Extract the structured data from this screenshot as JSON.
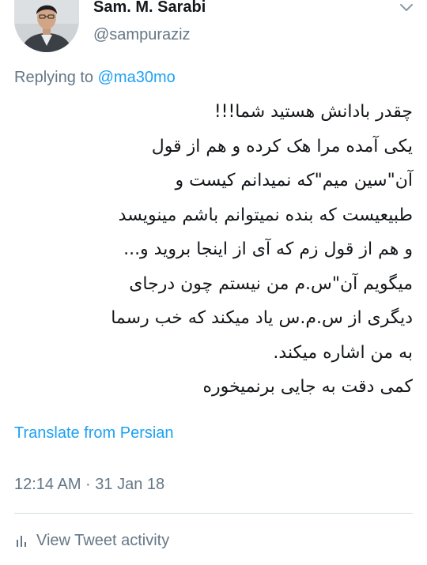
{
  "author": {
    "display_name": "Sam. M. Sarabi",
    "handle": "@sampuraziz"
  },
  "reply": {
    "prefix": "Replying to",
    "mention": "@ma30mo"
  },
  "tweet": {
    "lines": [
      "چقدر بادانش هستید شما!!!",
      "یکی آمده مرا هک کرده و هم از قول",
      "آن\"سین میم\"که نمیدانم کیست و",
      "طبیعیست که بنده نمیتوانم باشم مینویسد",
      "و هم از قول زم که آی از اینجا بروید و...",
      "میگویم آن\"س.م من نیستم چون درجای",
      "دیگری از س.م.س یاد میکند که خب رسما",
      "به من اشاره میکند.",
      "کمی دقت به جایی برنمیخوره"
    ]
  },
  "translate_label": "Translate from Persian",
  "timestamp": "12:14 AM · 31 Jan 18",
  "activity_label": "View Tweet activity",
  "icons": {
    "menu": "chevron-down-icon",
    "activity": "bar-chart-icon"
  },
  "colors": {
    "link": "#1da1f2",
    "secondary_text": "#657786",
    "primary_text": "#14171a",
    "divider": "#d6dde3"
  }
}
